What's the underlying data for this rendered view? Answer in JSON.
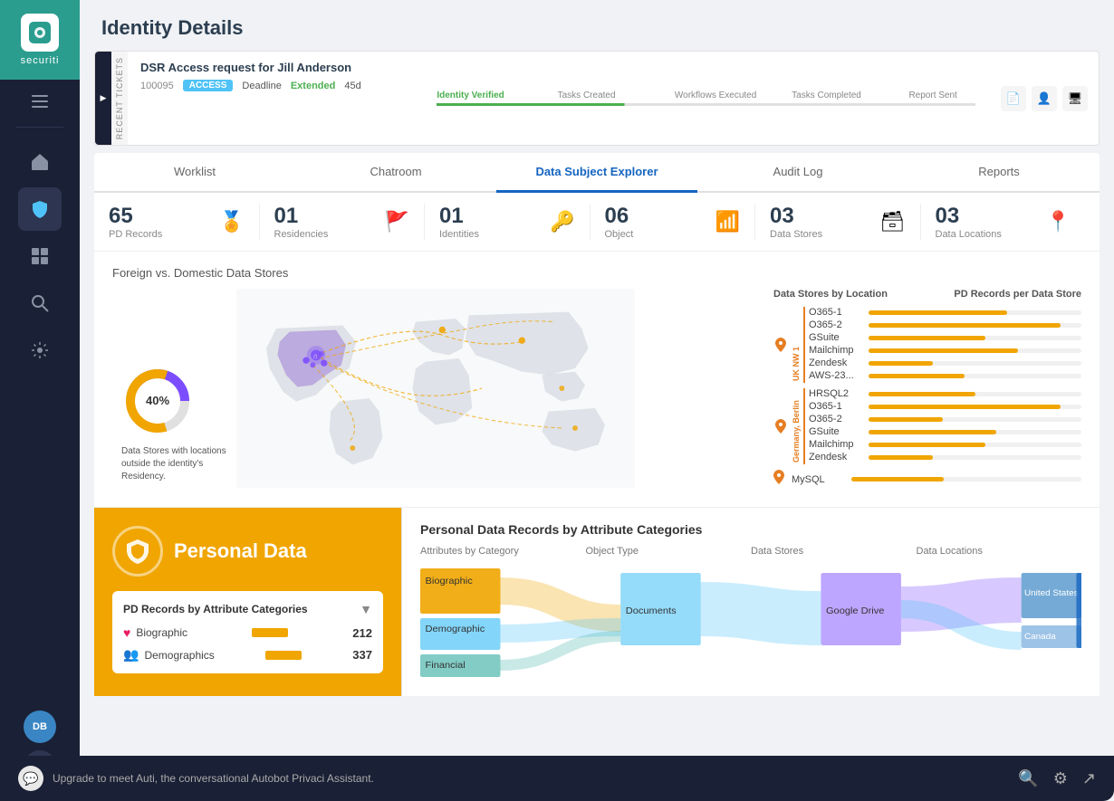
{
  "app": {
    "name": "securiti",
    "logo_text": "securiti"
  },
  "page": {
    "title": "Identity Details"
  },
  "ticket": {
    "title": "DSR Access request for Jill Anderson",
    "id": "100095",
    "badge": "ACCESS",
    "deadline_label": "Deadline",
    "deadline_status": "Extended",
    "deadline_days": "45d",
    "steps": [
      "Identity Verified",
      "Tasks Created",
      "Workflows Executed",
      "Tasks Completed",
      "Report Sent"
    ]
  },
  "tabs": {
    "items": [
      "Worklist",
      "Chatroom",
      "Data Subject Explorer",
      "Audit Log",
      "Reports"
    ],
    "active": 2
  },
  "stats": [
    {
      "number": "65",
      "label": "PD Records",
      "icon": "🏅"
    },
    {
      "number": "01",
      "label": "Residencies",
      "icon": "🚩"
    },
    {
      "number": "01",
      "label": "Identities",
      "icon": "🔑"
    },
    {
      "number": "06",
      "label": "Object",
      "icon": "📊"
    },
    {
      "number": "03",
      "label": "Data Stores",
      "icon": "🗃"
    },
    {
      "number": "03",
      "label": "Data Locations",
      "icon": "📍"
    }
  ],
  "map": {
    "title": "Foreign vs. Domestic Data Stores",
    "donut_percent": "40%",
    "donut_label": "Data Stores with locations outside the identity's Residency.",
    "ds_location_title": "Data Stores by Location",
    "pd_records_title": "PD Records per Data Store",
    "regions": [
      {
        "name": "UK NW 1",
        "stores": [
          {
            "name": "O365-1",
            "bar": 65
          },
          {
            "name": "O365-2",
            "bar": 90
          },
          {
            "name": "GSuite",
            "bar": 55
          },
          {
            "name": "Mailchimp",
            "bar": 70
          },
          {
            "name": "Zendesk",
            "bar": 30
          },
          {
            "name": "AWS-23...",
            "bar": 45
          }
        ]
      },
      {
        "name": "Germany, Berlin",
        "stores": [
          {
            "name": "HRSQL2",
            "bar": 50
          },
          {
            "name": "O365-1",
            "bar": 90
          },
          {
            "name": "O365-2",
            "bar": 35
          },
          {
            "name": "GSuite",
            "bar": 60
          },
          {
            "name": "Mailchimp",
            "bar": 55
          },
          {
            "name": "Zendesk",
            "bar": 30
          }
        ]
      },
      {
        "name": "",
        "stores": [
          {
            "name": "MySQL",
            "bar": 40
          }
        ]
      }
    ]
  },
  "personal_data": {
    "title": "Personal Data",
    "sub_title": "PD Records by Attribute Categories",
    "rows": [
      {
        "icon": "❤",
        "label": "Biographic",
        "count": "212"
      },
      {
        "icon": "👥",
        "label": "Demographics",
        "count": "337"
      }
    ]
  },
  "chart": {
    "title": "Personal Data Records by Attribute Categories",
    "columns": [
      "Attributes by Category",
      "Object Type",
      "Data Stores",
      "Data Locations"
    ],
    "categories": [
      "Biographic",
      "Demographic",
      "Financial"
    ],
    "object_types": [
      "Documents",
      ""
    ],
    "data_stores": [
      "Google Drive"
    ],
    "data_locations": [
      "United States",
      "Canada"
    ]
  },
  "footer": {
    "upgrade_text": "Upgrade to meet Auti, the conversational Autobot Privaci Assistant."
  }
}
